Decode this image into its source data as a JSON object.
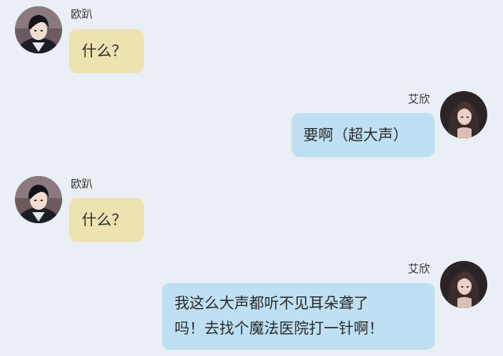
{
  "conversation": {
    "messages": [
      {
        "sender": "欧趴",
        "side": "left",
        "text": "什么？"
      },
      {
        "sender": "艾欣",
        "side": "right",
        "text": "要啊（超大声）"
      },
      {
        "sender": "欧趴",
        "side": "left",
        "text": "什么？"
      },
      {
        "sender": "艾欣",
        "side": "right",
        "lines": [
          "我这么大声都听不见耳朵聋了",
          "吗！去找个魔法医院打一针啊！"
        ]
      }
    ]
  },
  "colors": {
    "background": "#e9eff4",
    "left_bubble": "#ede2b0",
    "right_bubble": "#bfe0f3"
  },
  "icons": {
    "left_avatar": "boy-avatar",
    "right_avatar": "girl-avatar"
  }
}
